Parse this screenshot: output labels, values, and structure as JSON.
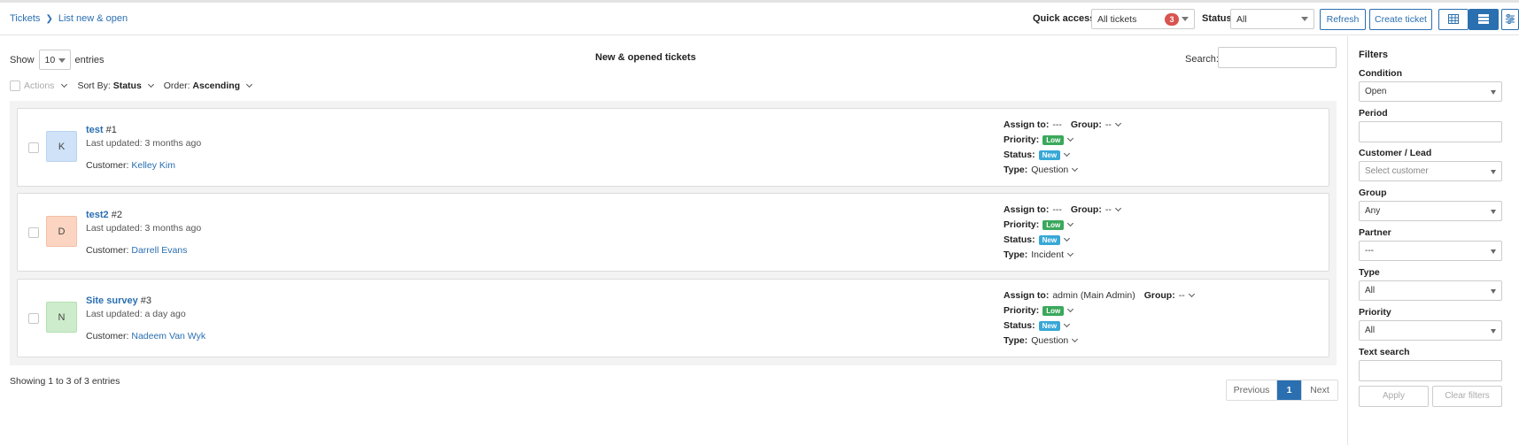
{
  "breadcrumb": {
    "root": "Tickets",
    "current": "List new & open"
  },
  "header": {
    "quick_access_label": "Quick access",
    "quick_access_value": "All tickets",
    "quick_access_badge": "3",
    "status_label": "Status",
    "status_value": "All",
    "refresh_label": "Refresh",
    "create_label": "Create ticket",
    "view_icons": [
      "table-icon",
      "list-icon",
      "filter-sliders-icon"
    ]
  },
  "list": {
    "show_label": "Show",
    "show_value": "10",
    "entries_label": "entries",
    "title": "New & opened tickets",
    "search_label": "Search:",
    "actions_label": "Actions",
    "sort_label": "Sort By:",
    "sort_value": "Status",
    "order_label": "Order:",
    "order_value": "Ascending",
    "showing_text": "Showing 1 to 3 of 3 entries",
    "pager": {
      "prev": "Previous",
      "current": "1",
      "next": "Next"
    }
  },
  "tickets": [
    {
      "initial": "K",
      "avatar_color": "#cfe2f7",
      "name": "test",
      "number": "#1",
      "updated": "Last updated: 3 months ago",
      "customer_label": "Customer:",
      "customer": "Kelley Kim",
      "assign_label": "Assign to:",
      "assign": "---",
      "group_label": "Group:",
      "group": "--",
      "priority_label": "Priority:",
      "priority": "Low",
      "status_label": "Status:",
      "status": "New",
      "type_label": "Type:",
      "type": "Question"
    },
    {
      "initial": "D",
      "avatar_color": "#fbd5c1",
      "name": "test2",
      "number": "#2",
      "updated": "Last updated: 3 months ago",
      "customer_label": "Customer:",
      "customer": "Darrell Evans",
      "assign_label": "Assign to:",
      "assign": "---",
      "group_label": "Group:",
      "group": "--",
      "priority_label": "Priority:",
      "priority": "Low",
      "status_label": "Status:",
      "status": "New",
      "type_label": "Type:",
      "type": "Incident"
    },
    {
      "initial": "N",
      "avatar_color": "#cdeccb",
      "name": "Site survey",
      "number": "#3",
      "updated": "Last updated: a day ago",
      "customer_label": "Customer:",
      "customer": "Nadeem Van Wyk",
      "assign_label": "Assign to:",
      "assign": "admin (Main Admin)",
      "group_label": "Group:",
      "group": "--",
      "priority_label": "Priority:",
      "priority": "Low",
      "status_label": "Status:",
      "status": "New",
      "type_label": "Type:",
      "type": "Question"
    }
  ],
  "filters": {
    "title": "Filters",
    "condition_label": "Condition",
    "condition_value": "Open",
    "period_label": "Period",
    "customer_label": "Customer / Lead",
    "customer_placeholder": "Select customer",
    "group_label": "Group",
    "group_value": "Any",
    "partner_label": "Partner",
    "partner_value": "---",
    "type_label": "Type",
    "type_value": "All",
    "priority_label": "Priority",
    "priority_value": "All",
    "text_search_label": "Text search",
    "apply_label": "Apply",
    "clear_label": "Clear filters"
  },
  "colors": {
    "accent": "#2a6fb0",
    "badge_red": "#d9534f",
    "low": "#3aa85c",
    "new": "#38a8d6"
  }
}
